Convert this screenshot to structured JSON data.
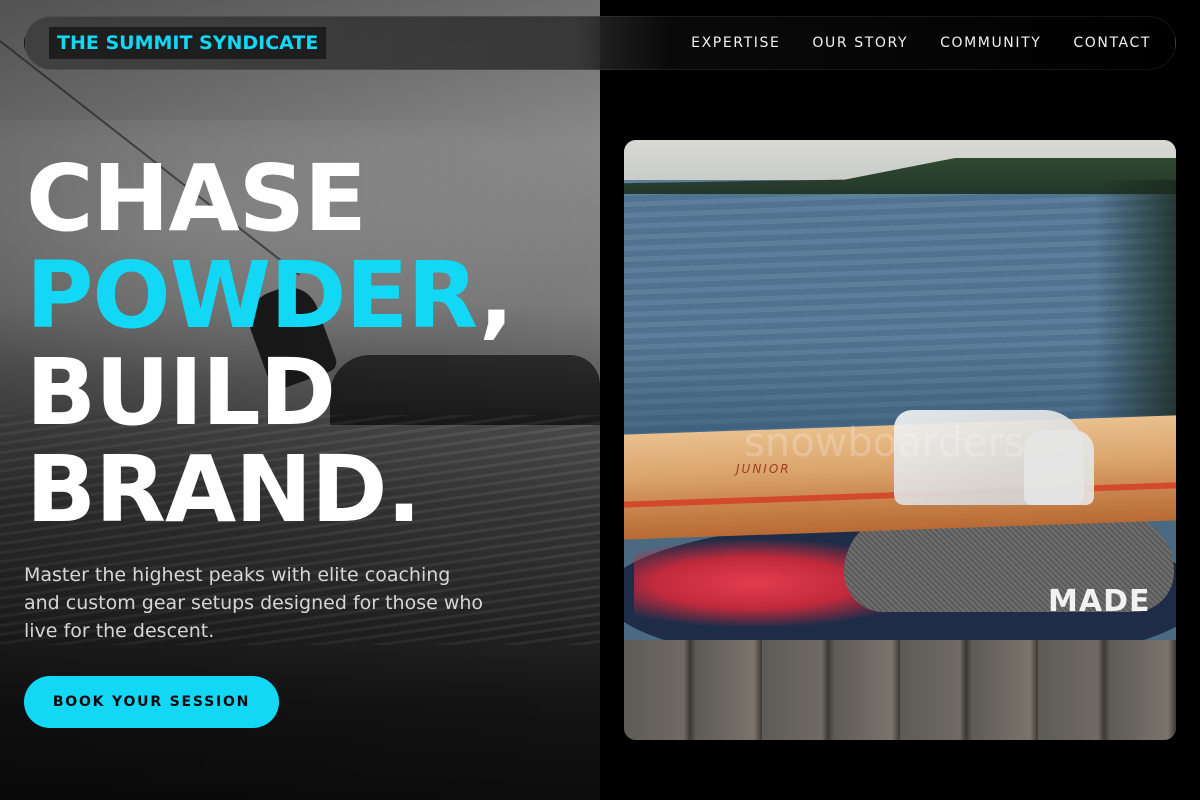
{
  "nav": {
    "brand": "THE SUMMIT SYNDICATE",
    "links": [
      "EXPERTISE",
      "OUR STORY",
      "COMMUNITY",
      "CONTACT"
    ]
  },
  "hero": {
    "line1": "CHASE",
    "line2_accent": "POWDER",
    "line2_rest": ",",
    "line3": "BUILD",
    "line4": "BRAND.",
    "subtext": "Master the highest peaks with elite coaching and custom gear setups designed for those who live for the descent.",
    "cta": "BOOK YOUR SESSION"
  },
  "image_card": {
    "ski_label": "JUNIOR",
    "watermark": "snowboarders",
    "board_text": "MADE"
  },
  "colors": {
    "accent": "#12d8f5",
    "background": "#000000",
    "text": "#ffffff"
  }
}
